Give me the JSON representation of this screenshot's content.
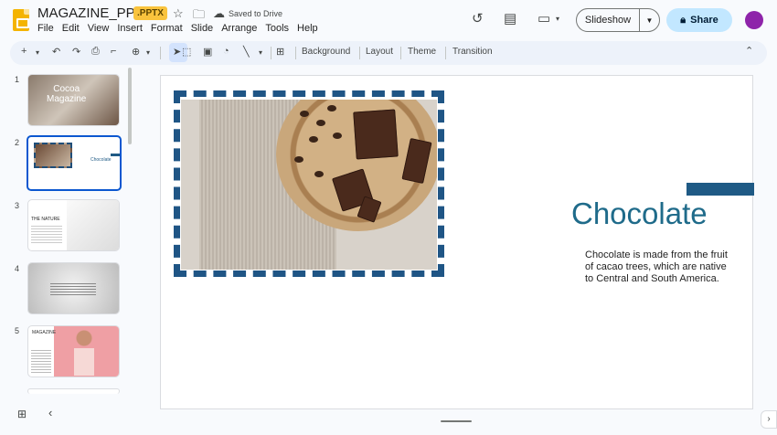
{
  "document": {
    "title": "MAGAZINE_PPTX",
    "badge": ".PPTX",
    "save_status": "Saved to Drive"
  },
  "menu": [
    "File",
    "Edit",
    "View",
    "Insert",
    "Format",
    "Slide",
    "Arrange",
    "Tools",
    "Help"
  ],
  "header_actions": {
    "slideshow_label": "Slideshow",
    "share_label": "Share"
  },
  "toolbar": {
    "background_label": "Background",
    "layout_label": "Layout",
    "theme_label": "Theme",
    "transition_label": "Transition"
  },
  "filmstrip": {
    "slides": [
      {
        "number": "1",
        "title": "Cocoa\nMagazine"
      },
      {
        "number": "2",
        "title": "Chocolate"
      },
      {
        "number": "3",
        "title": "THE NATURE"
      },
      {
        "number": "4",
        "title": ""
      },
      {
        "number": "5",
        "title": "MAGAZINE"
      }
    ],
    "active_index": 1
  },
  "slide": {
    "title": "Chocolate",
    "body": "Chocolate is made from the fruit of cacao trees, which are native to Central and South America."
  },
  "colors": {
    "accent": "#1f5a85",
    "title": "#1f6b8a",
    "share_bg": "#c2e7ff",
    "badge_bg": "#f9c33d",
    "active_thumb_border": "#0b57d0",
    "avatar": "#8e24aa"
  }
}
